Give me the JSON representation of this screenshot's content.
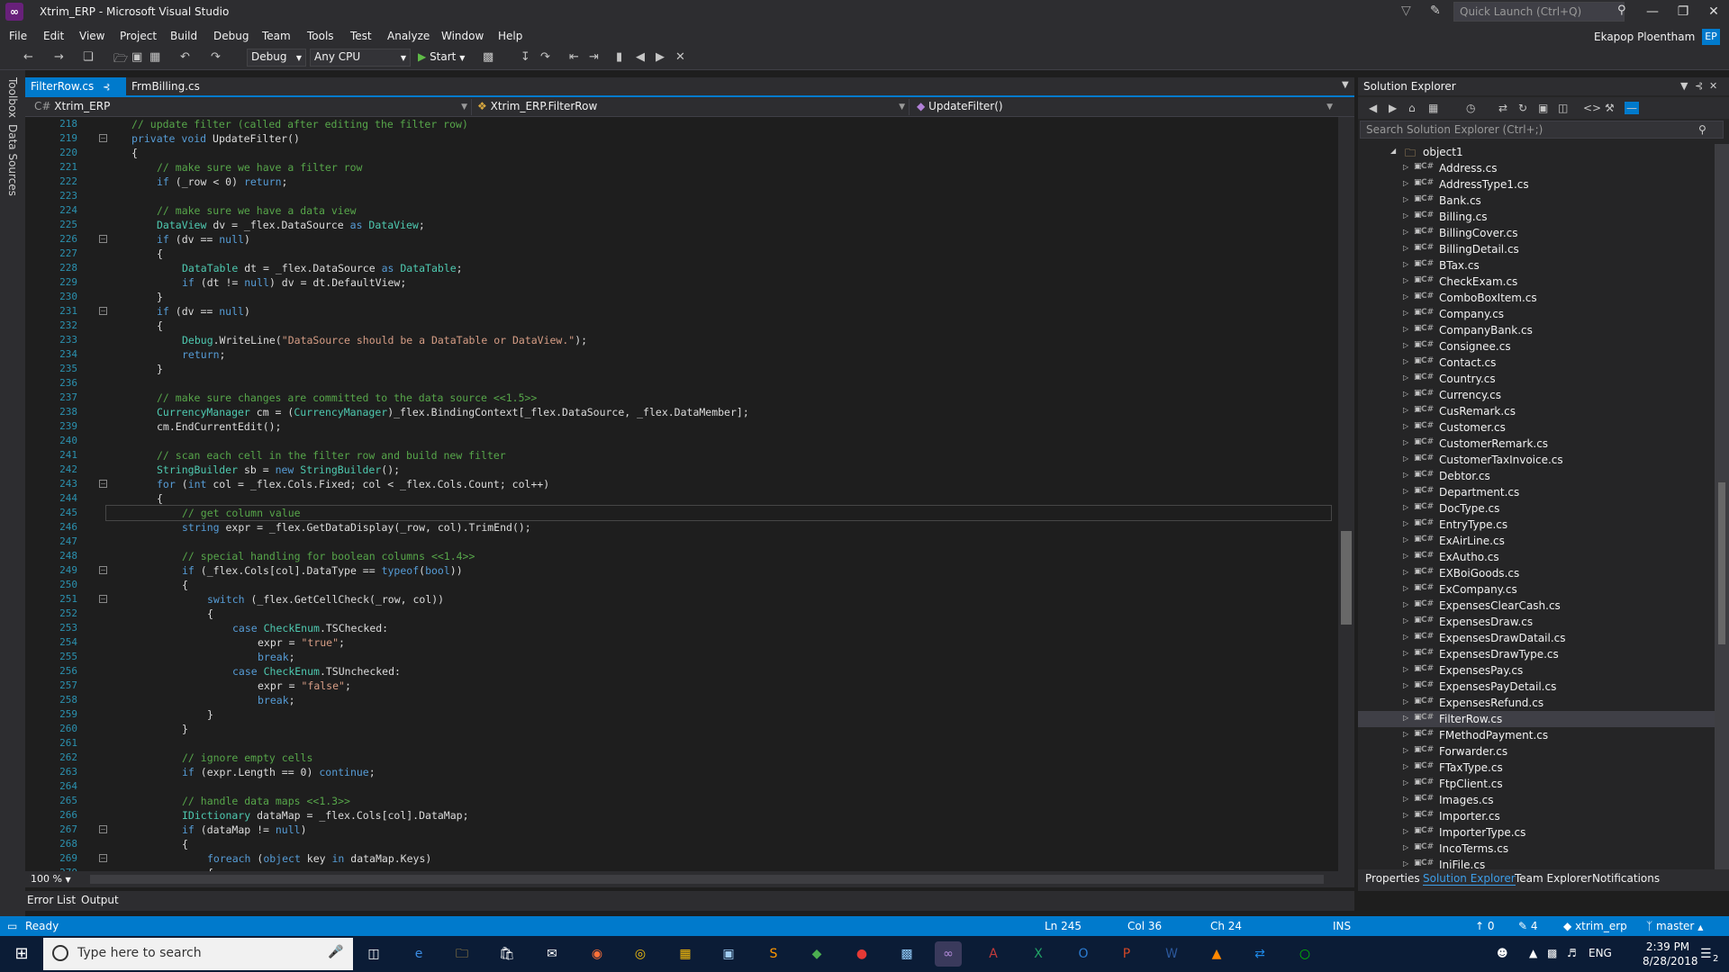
{
  "window": {
    "title": "Xtrim_ERP - Microsoft Visual Studio",
    "quick_launch_placeholder": "Quick Launch (Ctrl+Q)",
    "user_name": "Ekapop Ploentham",
    "user_initials": "EP"
  },
  "menu": [
    "File",
    "Edit",
    "View",
    "Project",
    "Build",
    "Debug",
    "Team",
    "Tools",
    "Test",
    "Analyze",
    "Window",
    "Help"
  ],
  "toolbar": {
    "config": "Debug",
    "platform": "Any CPU",
    "start_label": "Start"
  },
  "side_strip": [
    "Toolbox",
    "Data Sources"
  ],
  "tabs": [
    {
      "label": "FilterRow.cs",
      "active": true
    },
    {
      "label": "FrmBilling.cs",
      "active": false
    }
  ],
  "navbar": {
    "project": "Xtrim_ERP",
    "class": "Xtrim_ERP.FilterRow",
    "member": "UpdateFilter()"
  },
  "editor": {
    "zoom": "100 %",
    "lines": [
      {
        "n": 218,
        "i": 1,
        "t": [
          [
            "c",
            "// update filter (called after editing the filter row)"
          ]
        ]
      },
      {
        "n": 219,
        "i": 1,
        "t": [
          [
            "k",
            "private "
          ],
          [
            "k",
            "void "
          ],
          [
            "p",
            "UpdateFilter()"
          ]
        ]
      },
      {
        "n": 220,
        "i": 1,
        "t": [
          [
            "p",
            "{"
          ]
        ]
      },
      {
        "n": 221,
        "i": 2,
        "t": [
          [
            "c",
            "// make sure we have a filter row"
          ]
        ]
      },
      {
        "n": 222,
        "i": 2,
        "t": [
          [
            "k",
            "if "
          ],
          [
            "p",
            "(_row < 0) "
          ],
          [
            "k",
            "return"
          ],
          [
            "p",
            ";"
          ]
        ]
      },
      {
        "n": 223,
        "i": 0,
        "t": []
      },
      {
        "n": 224,
        "i": 2,
        "t": [
          [
            "c",
            "// make sure we have a data view"
          ]
        ]
      },
      {
        "n": 225,
        "i": 2,
        "t": [
          [
            "y",
            "DataView "
          ],
          [
            "p",
            "dv = _flex.DataSource "
          ],
          [
            "k",
            "as "
          ],
          [
            "y",
            "DataView"
          ],
          [
            "p",
            ";"
          ]
        ]
      },
      {
        "n": 226,
        "i": 2,
        "t": [
          [
            "k",
            "if "
          ],
          [
            "p",
            "(dv == "
          ],
          [
            "k",
            "null"
          ],
          [
            "p",
            ")"
          ]
        ]
      },
      {
        "n": 227,
        "i": 2,
        "t": [
          [
            "p",
            "{"
          ]
        ]
      },
      {
        "n": 228,
        "i": 3,
        "t": [
          [
            "y",
            "DataTable "
          ],
          [
            "p",
            "dt = _flex.DataSource "
          ],
          [
            "k",
            "as "
          ],
          [
            "y",
            "DataTable"
          ],
          [
            "p",
            ";"
          ]
        ]
      },
      {
        "n": 229,
        "i": 3,
        "t": [
          [
            "k",
            "if "
          ],
          [
            "p",
            "(dt != "
          ],
          [
            "k",
            "null"
          ],
          [
            "p",
            ") dv = dt.DefaultView;"
          ]
        ]
      },
      {
        "n": 230,
        "i": 2,
        "t": [
          [
            "p",
            "}"
          ]
        ]
      },
      {
        "n": 231,
        "i": 2,
        "t": [
          [
            "k",
            "if "
          ],
          [
            "p",
            "(dv == "
          ],
          [
            "k",
            "null"
          ],
          [
            "p",
            ")"
          ]
        ]
      },
      {
        "n": 232,
        "i": 2,
        "t": [
          [
            "p",
            "{"
          ]
        ]
      },
      {
        "n": 233,
        "i": 3,
        "t": [
          [
            "y",
            "Debug"
          ],
          [
            "p",
            ".WriteLine("
          ],
          [
            "s",
            "\"DataSource should be a DataTable or DataView.\""
          ],
          [
            "p",
            ");"
          ]
        ]
      },
      {
        "n": 234,
        "i": 3,
        "t": [
          [
            "k",
            "return"
          ],
          [
            "p",
            ";"
          ]
        ]
      },
      {
        "n": 235,
        "i": 2,
        "t": [
          [
            "p",
            "}"
          ]
        ]
      },
      {
        "n": 236,
        "i": 0,
        "t": []
      },
      {
        "n": 237,
        "i": 2,
        "t": [
          [
            "c",
            "// make sure changes are committed to the data source <<1.5>>"
          ]
        ]
      },
      {
        "n": 238,
        "i": 2,
        "t": [
          [
            "y",
            "CurrencyManager "
          ],
          [
            "p",
            "cm = ("
          ],
          [
            "y",
            "CurrencyManager"
          ],
          [
            "p",
            ")_flex.BindingContext[_flex.DataSource, _flex.DataMember];"
          ]
        ]
      },
      {
        "n": 239,
        "i": 2,
        "t": [
          [
            "p",
            "cm.EndCurrentEdit();"
          ]
        ]
      },
      {
        "n": 240,
        "i": 0,
        "t": []
      },
      {
        "n": 241,
        "i": 2,
        "t": [
          [
            "c",
            "// scan each cell in the filter row and build new filter"
          ]
        ]
      },
      {
        "n": 242,
        "i": 2,
        "t": [
          [
            "y",
            "StringBuilder "
          ],
          [
            "p",
            "sb = "
          ],
          [
            "k",
            "new "
          ],
          [
            "y",
            "StringBuilder"
          ],
          [
            "p",
            "();"
          ]
        ]
      },
      {
        "n": 243,
        "i": 2,
        "t": [
          [
            "k",
            "for "
          ],
          [
            "p",
            "("
          ],
          [
            "k",
            "int "
          ],
          [
            "p",
            "col = _flex.Cols.Fixed; col < _flex.Cols.Count; col++)"
          ]
        ]
      },
      {
        "n": 244,
        "i": 2,
        "t": [
          [
            "p",
            "{"
          ]
        ]
      },
      {
        "n": 245,
        "i": 3,
        "t": [
          [
            "c",
            "// get column value"
          ]
        ],
        "current": true
      },
      {
        "n": 246,
        "i": 3,
        "t": [
          [
            "k",
            "string "
          ],
          [
            "p",
            "expr = _flex.GetDataDisplay(_row, col).TrimEnd();"
          ]
        ]
      },
      {
        "n": 247,
        "i": 0,
        "t": []
      },
      {
        "n": 248,
        "i": 3,
        "t": [
          [
            "c",
            "// special handling for boolean columns <<1.4>>"
          ]
        ]
      },
      {
        "n": 249,
        "i": 3,
        "t": [
          [
            "k",
            "if "
          ],
          [
            "p",
            "(_flex.Cols[col].DataType == "
          ],
          [
            "k",
            "typeof"
          ],
          [
            "p",
            "("
          ],
          [
            "k",
            "bool"
          ],
          [
            "p",
            "))"
          ]
        ]
      },
      {
        "n": 250,
        "i": 3,
        "t": [
          [
            "p",
            "{"
          ]
        ]
      },
      {
        "n": 251,
        "i": 4,
        "t": [
          [
            "k",
            "switch "
          ],
          [
            "p",
            "(_flex.GetCellCheck(_row, col))"
          ]
        ]
      },
      {
        "n": 252,
        "i": 4,
        "t": [
          [
            "p",
            "{"
          ]
        ]
      },
      {
        "n": 253,
        "i": 5,
        "t": [
          [
            "k",
            "case "
          ],
          [
            "y",
            "CheckEnum"
          ],
          [
            "p",
            ".TSChecked:"
          ]
        ]
      },
      {
        "n": 254,
        "i": 6,
        "t": [
          [
            "p",
            "expr = "
          ],
          [
            "s",
            "\"true\""
          ],
          [
            "p",
            ";"
          ]
        ]
      },
      {
        "n": 255,
        "i": 6,
        "t": [
          [
            "k",
            "break"
          ],
          [
            "p",
            ";"
          ]
        ]
      },
      {
        "n": 256,
        "i": 5,
        "t": [
          [
            "k",
            "case "
          ],
          [
            "y",
            "CheckEnum"
          ],
          [
            "p",
            ".TSUnchecked:"
          ]
        ]
      },
      {
        "n": 257,
        "i": 6,
        "t": [
          [
            "p",
            "expr = "
          ],
          [
            "s",
            "\"false\""
          ],
          [
            "p",
            ";"
          ]
        ]
      },
      {
        "n": 258,
        "i": 6,
        "t": [
          [
            "k",
            "break"
          ],
          [
            "p",
            ";"
          ]
        ]
      },
      {
        "n": 259,
        "i": 4,
        "t": [
          [
            "p",
            "}"
          ]
        ]
      },
      {
        "n": 260,
        "i": 3,
        "t": [
          [
            "p",
            "}"
          ]
        ]
      },
      {
        "n": 261,
        "i": 0,
        "t": []
      },
      {
        "n": 262,
        "i": 3,
        "t": [
          [
            "c",
            "// ignore empty cells"
          ]
        ]
      },
      {
        "n": 263,
        "i": 3,
        "t": [
          [
            "k",
            "if "
          ],
          [
            "p",
            "(expr.Length == 0) "
          ],
          [
            "k",
            "continue"
          ],
          [
            "p",
            ";"
          ]
        ]
      },
      {
        "n": 264,
        "i": 0,
        "t": []
      },
      {
        "n": 265,
        "i": 3,
        "t": [
          [
            "c",
            "// handle data maps <<1.3>>"
          ]
        ]
      },
      {
        "n": 266,
        "i": 3,
        "t": [
          [
            "y",
            "IDictionary "
          ],
          [
            "p",
            "dataMap = _flex.Cols[col].DataMap;"
          ]
        ]
      },
      {
        "n": 267,
        "i": 3,
        "t": [
          [
            "k",
            "if "
          ],
          [
            "p",
            "(dataMap != "
          ],
          [
            "k",
            "null"
          ],
          [
            "p",
            ")"
          ]
        ]
      },
      {
        "n": 268,
        "i": 3,
        "t": [
          [
            "p",
            "{"
          ]
        ]
      },
      {
        "n": 269,
        "i": 4,
        "t": [
          [
            "k",
            "foreach "
          ],
          [
            "p",
            "("
          ],
          [
            "k",
            "object "
          ],
          [
            "p",
            "key "
          ],
          [
            "k",
            "in "
          ],
          [
            "p",
            "dataMap.Keys)"
          ]
        ]
      },
      {
        "n": 270,
        "i": 4,
        "t": [
          [
            "p",
            "{"
          ]
        ]
      }
    ]
  },
  "bottom_tabs": [
    "Error List",
    "Output"
  ],
  "solution_explorer": {
    "title": "Solution Explorer",
    "search_placeholder": "Search Solution Explorer (Ctrl+;)",
    "root": "object1",
    "files": [
      "Address.cs",
      "AddressType1.cs",
      "Bank.cs",
      "Billing.cs",
      "BillingCover.cs",
      "BillingDetail.cs",
      "BTax.cs",
      "CheckExam.cs",
      "ComboBoxItem.cs",
      "Company.cs",
      "CompanyBank.cs",
      "Consignee.cs",
      "Contact.cs",
      "Country.cs",
      "Currency.cs",
      "CusRemark.cs",
      "Customer.cs",
      "CustomerRemark.cs",
      "CustomerTaxInvoice.cs",
      "Debtor.cs",
      "Department.cs",
      "DocType.cs",
      "EntryType.cs",
      "ExAirLine.cs",
      "ExAutho.cs",
      "EXBoiGoods.cs",
      "ExCompany.cs",
      "ExpensesClearCash.cs",
      "ExpensesDraw.cs",
      "ExpensesDrawDatail.cs",
      "ExpensesDrawType.cs",
      "ExpensesPay.cs",
      "ExpensesPayDetail.cs",
      "ExpensesRefund.cs",
      "FilterRow.cs",
      "FMethodPayment.cs",
      "Forwarder.cs",
      "FTaxType.cs",
      "FtpClient.cs",
      "Images.cs",
      "Importer.cs",
      "ImporterType.cs",
      "IncoTerms.cs",
      "IniFile.cs"
    ],
    "selected": "FilterRow.cs",
    "bottom_tabs": [
      "Properties",
      "Solution Explorer",
      "Team Explorer",
      "Notifications"
    ]
  },
  "status": {
    "state": "Ready",
    "ln": "Ln 245",
    "col": "Col 36",
    "ch": "Ch 24",
    "mode": "INS",
    "up_count": "0",
    "pencil_count": "4",
    "repo": "xtrim_erp",
    "branch": "master"
  },
  "taskbar": {
    "search_placeholder": "Type here to search",
    "lang": "ENG",
    "time": "2:39 PM",
    "date": "8/28/2018",
    "notifications": "2"
  }
}
